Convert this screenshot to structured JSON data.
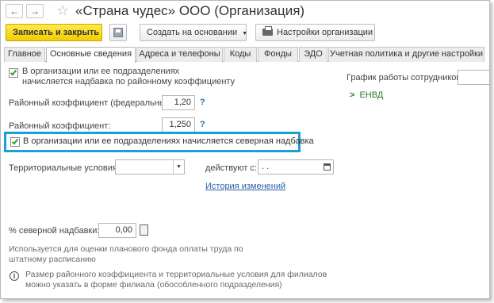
{
  "window": {
    "title": "«Страна чудес» ООО (Организация)"
  },
  "nav": {
    "back_icon": "arrow-left-icon",
    "forward_icon": "arrow-right-icon",
    "favorite_icon": "star-icon"
  },
  "toolbar": {
    "save_close_label": "Записать и закрыть",
    "create_based_label": "Создать на основании",
    "settings_label": "Настройки организации"
  },
  "tabs": [
    {
      "label": "Главное"
    },
    {
      "label": "Основные сведения"
    },
    {
      "label": "Адреса и телефоны"
    },
    {
      "label": "Коды"
    },
    {
      "label": "Фонды"
    },
    {
      "label": "ЭДО"
    },
    {
      "label": "Учетная политика и другие настройки"
    }
  ],
  "form": {
    "regional_checkbox_label_line1": "В организации или ее подразделениях",
    "regional_checkbox_label_line2": "начисляется надбавка по районному коэффициенту",
    "regional_checked": true,
    "schedule_label": "График работы сотрудников:",
    "envd_label": "ЕНВД",
    "federal_coef_label": "Районный коэффициент (федеральный):",
    "federal_coef_value": "1,20",
    "coef_label": "Районный коэффициент:",
    "coef_value": "1,250",
    "question_mark": "?",
    "northern_checkbox_label": "В организации или ее подразделениях начисляется северная надбавка",
    "northern_checked": true,
    "territorial_label": "Территориальные условия:",
    "territorial_value": "",
    "valid_from_label": "действуют с:",
    "valid_from_value": " .  .",
    "history_link": "История изменений",
    "northern_percent_label": "% северной надбавки:",
    "northern_percent_value": "0,00",
    "hint_fund_line1": "Используется для оценки планового фонда оплаты труда по",
    "hint_fund_line2": "штатному расписанию",
    "hint_branch_line1": "Размер районного коэффициента и территориальные условия для филиалов",
    "hint_branch_line2": "можно указать в форме филиала (обособленного подразделения)",
    "info_glyph": "i",
    "chevron_glyph": ">"
  },
  "colors": {
    "accent": "#1a9fd8",
    "primary_button": "#f2cd00"
  }
}
